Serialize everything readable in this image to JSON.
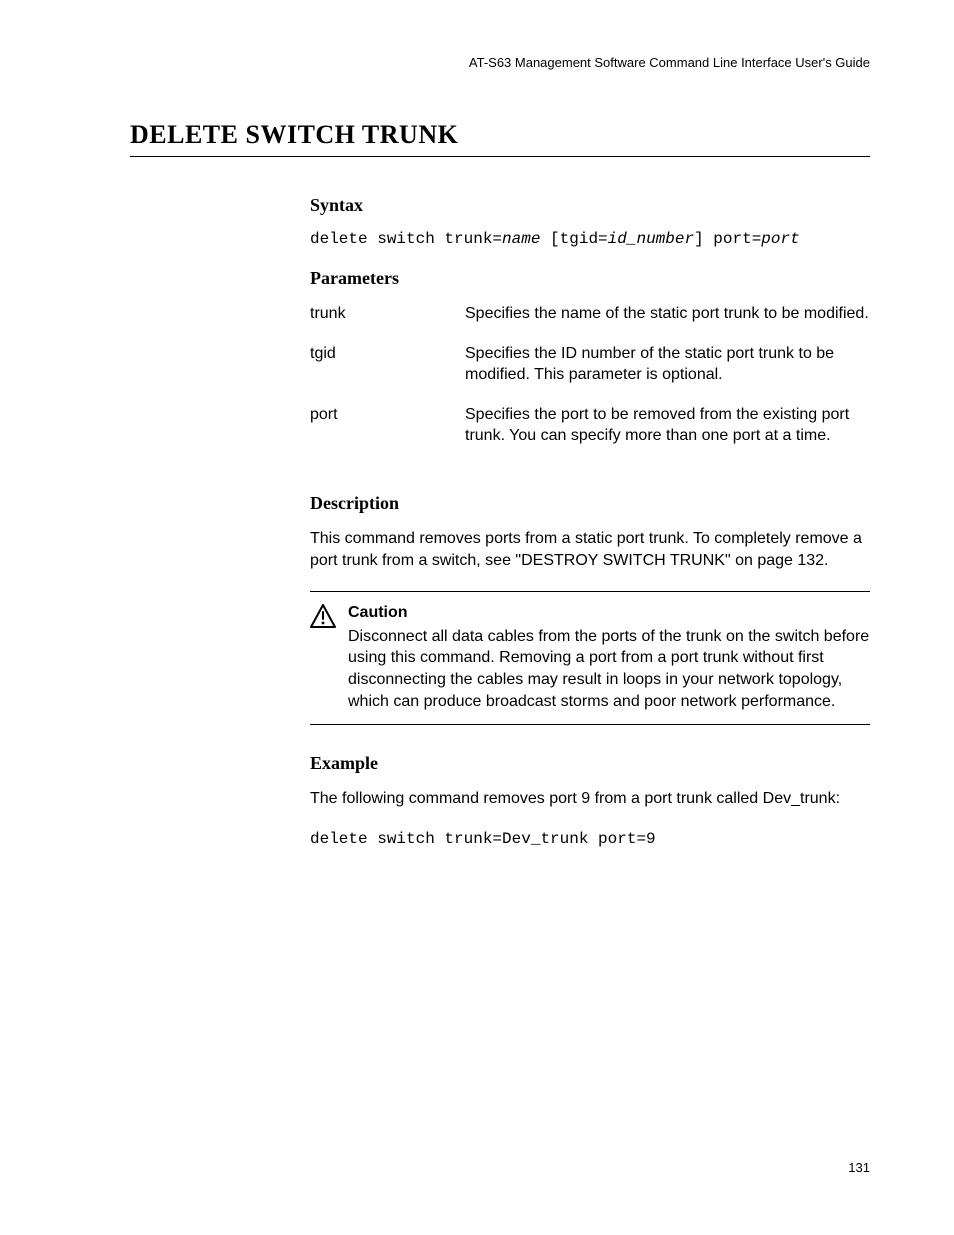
{
  "header": "AT-S63 Management Software Command Line Interface User's Guide",
  "title": "DELETE SWITCH TRUNK",
  "syntax": {
    "heading": "Syntax",
    "parts": {
      "p1": "delete switch trunk=",
      "name": "name",
      "p2": " [tgid=",
      "id": "id_number",
      "p3": "] port=",
      "port": "port"
    }
  },
  "parameters": {
    "heading": "Parameters",
    "rows": [
      {
        "name": "trunk",
        "desc": "Specifies the name of the static port trunk to be modified."
      },
      {
        "name": "tgid",
        "desc": "Specifies the ID number of the static port trunk to be modified. This parameter is optional."
      },
      {
        "name": "port",
        "desc": "Specifies the port to be removed from the existing port trunk. You can specify more than one port at a time."
      }
    ]
  },
  "description": {
    "heading": "Description",
    "body": "This command removes ports from a static port trunk. To completely remove a port trunk from a switch, see \"DESTROY SWITCH TRUNK\" on page 132."
  },
  "caution": {
    "caption": "Caution",
    "body": "Disconnect all data cables from the ports of the trunk on the switch before using this command. Removing a port from a port trunk without first disconnecting the cables may result in loops in your network topology, which can produce broadcast storms and poor network performance."
  },
  "example": {
    "heading": "Example",
    "intro": "The following command removes port 9 from a port trunk called Dev_trunk:",
    "cmd": "delete switch trunk=Dev_trunk port=9"
  },
  "page_number": "131"
}
